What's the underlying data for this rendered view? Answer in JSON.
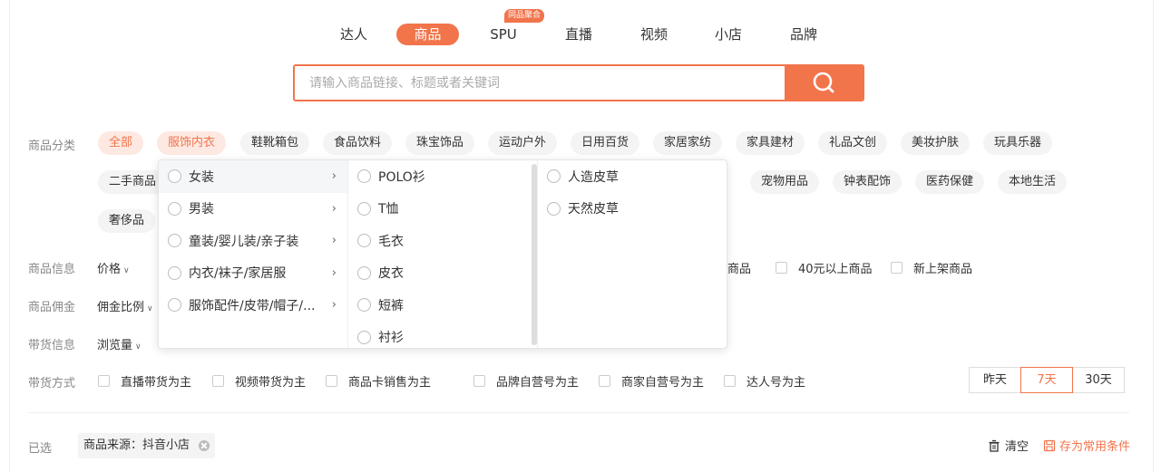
{
  "tabs": [
    {
      "label": "达人",
      "active": false
    },
    {
      "label": "商品",
      "active": true
    },
    {
      "label": "SPU",
      "active": false,
      "badge": "同品聚合"
    },
    {
      "label": "直播",
      "active": false
    },
    {
      "label": "视频",
      "active": false
    },
    {
      "label": "小店",
      "active": false
    },
    {
      "label": "品牌",
      "active": false
    }
  ],
  "search": {
    "placeholder": "请输入商品链接、标题或者关键词",
    "value": "",
    "icon": "search-icon"
  },
  "category": {
    "label": "商品分类",
    "row1": [
      "全部",
      "服饰内衣",
      "鞋靴箱包",
      "食品饮料",
      "珠宝饰品",
      "运动户外",
      "日用百货",
      "家居家纺",
      "家具建材",
      "礼品文创",
      "美妆护肤",
      "玩具乐器"
    ],
    "row2": [
      "二手商品",
      "宠物用品",
      "钟表配饰",
      "医药保健",
      "本地生活"
    ],
    "row3": [
      "奢侈品"
    ]
  },
  "info": {
    "label": "商品信息",
    "dropdown": "价格",
    "checkboxes": [
      "商品",
      "40元以上商品",
      "新上架商品"
    ]
  },
  "commission": {
    "label": "商品佣金",
    "dropdown": "佣金比例"
  },
  "sales": {
    "label": "带货信息",
    "dropdown": "浏览量"
  },
  "method": {
    "label": "带货方式",
    "checkboxes": [
      "直播带货为主",
      "视频带货为主",
      "商品卡销售为主",
      "品牌自营号为主",
      "商家自营号为主",
      "达人号为主"
    ]
  },
  "days": [
    {
      "label": "昨天",
      "active": false
    },
    {
      "label": "7天",
      "active": true
    },
    {
      "label": "30天",
      "active": false
    }
  ],
  "selected": {
    "label": "已选",
    "tag": "商品来源：抖音小店",
    "clear": "清空",
    "save": "存为常用条件"
  },
  "cascader": {
    "col1": [
      "女装",
      "男装",
      "童装/婴儿装/亲子装",
      "内衣/袜子/家居服",
      "服饰配件/皮带/帽子/..."
    ],
    "col2": [
      "POLO衫",
      "T恤",
      "毛衣",
      "皮衣",
      "短裤",
      "衬衫"
    ],
    "col3": [
      "人造皮草",
      "天然皮草"
    ]
  },
  "colors": {
    "accent": "#f2744b"
  }
}
